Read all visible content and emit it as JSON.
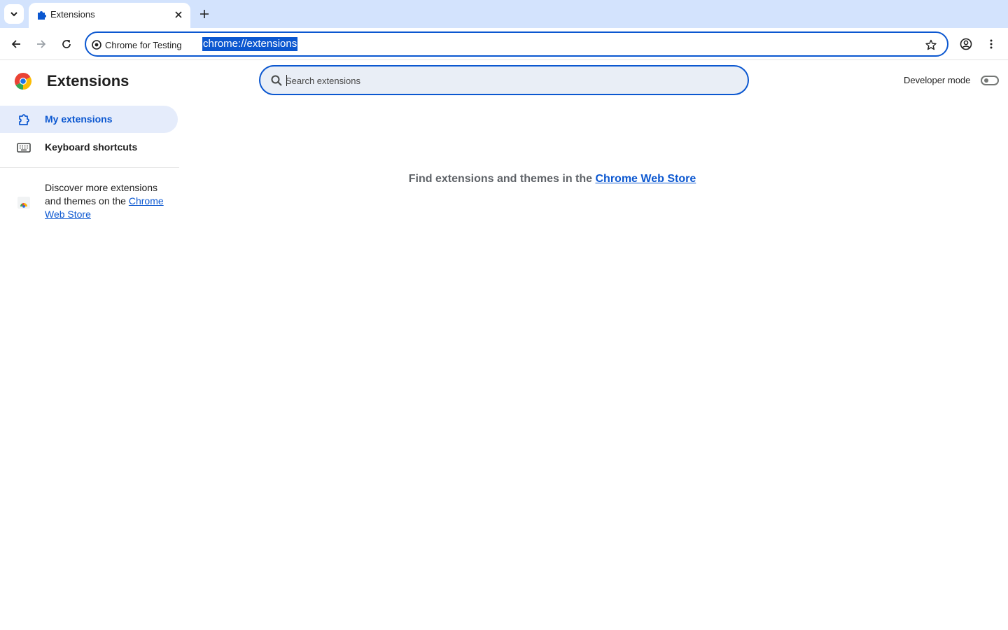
{
  "tab": {
    "title": "Extensions"
  },
  "omnibox": {
    "site_label": "Chrome for Testing",
    "url": "chrome://extensions"
  },
  "page": {
    "title": "Extensions",
    "search_placeholder": "Search extensions",
    "developer_mode": {
      "label": "Developer mode",
      "enabled": false
    }
  },
  "sidebar": {
    "items": [
      {
        "label": "My extensions",
        "icon": "extension-puzzle-icon",
        "selected": true
      },
      {
        "label": "Keyboard shortcuts",
        "icon": "keyboard-icon",
        "selected": false
      }
    ],
    "discover": {
      "text": "Discover more extensions and themes on the",
      "link": "Chrome Web Store"
    }
  },
  "main": {
    "empty_text": "Find extensions and themes in the",
    "empty_link": "Chrome Web Store"
  },
  "colors": {
    "accent": "#0b57d0",
    "tabstrip": "#d3e3fd",
    "selected_nav": "#e5ecfb"
  }
}
